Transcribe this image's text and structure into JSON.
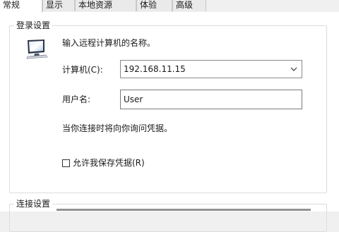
{
  "tabs": [
    {
      "label": "常规"
    },
    {
      "label": "显示"
    },
    {
      "label": "本地资源"
    },
    {
      "label": "体验"
    },
    {
      "label": "高级"
    }
  ],
  "login": {
    "group_title": "登录设置",
    "instruction": "输入远程计算机的名称。",
    "computer_label": "计算机(C):",
    "computer_value": "192.168.11.15",
    "username_label": "用户名:",
    "username_value": "User",
    "prompt_note": "当你连接时将向你询问凭据。",
    "save_credentials_label": "允许我保存凭据(R)",
    "save_credentials_checked": false
  },
  "connection": {
    "group_title": "连接设置"
  },
  "icons": {
    "computer": "computer-monitor-icon",
    "dropdown": "chevron-down-icon"
  }
}
